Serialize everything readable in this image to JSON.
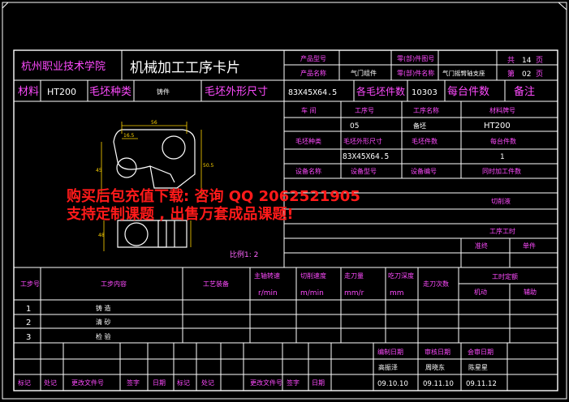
{
  "header": {
    "school": "杭州职业技术学院",
    "card_title": "机械加工工序卡片",
    "product_model_label": "产品型号",
    "product_name_label": "产品名称",
    "product_name_value": "气门组件",
    "part_drawing_label": "零(部)件图号",
    "part_name_label": "零(部)件名称",
    "part_name_value": "气门摇臂轴支座",
    "total_label": "共",
    "total_pages": "14",
    "page_unit_1": "页",
    "current_label": "第",
    "current_page": "02",
    "page_unit_2": "页"
  },
  "material_row": {
    "material_label": "材料",
    "material_value": "HT200",
    "blank_type_label": "毛坯种类",
    "blank_type_value": "铸件",
    "blank_size_label": "毛坯外形尺寸",
    "blank_size_value": "83X45X64.5",
    "blank_count_label": "各毛坯件数",
    "blank_count_value": "10303",
    "per_unit_label": "每台件数",
    "remark_label": "备注"
  },
  "right_panel": {
    "workshop_label": "车  间",
    "process_no_label": "工序号",
    "process_name_label": "工序名称",
    "material_no_label": "材料牌号",
    "process_no_value": "05",
    "process_name_value": "备坯",
    "material_no_value": "HT200",
    "blank_type_label": "毛坯种类",
    "blank_size_label": "毛坯外形尺寸",
    "blank_count_label": "毛坯件数",
    "per_unit_label": "每台件数",
    "blank_size_value": "83X45X64.5",
    "per_unit_value": "1",
    "equip_name_label": "设备名称",
    "equip_model_label": "设备型号",
    "equip_no_label": "设备编号",
    "concurrent_label": "同时加工件数",
    "coolant_label": "切削液",
    "hours_label": "工序工时",
    "standard_label": "准终",
    "unit_label": "单件"
  },
  "drawing": {
    "scale_label": "比例1: 2",
    "dim_56": "56",
    "dim_16_5": "16.5",
    "dim_45": "45",
    "dim_50_5": "50.5",
    "dim_48": "48"
  },
  "watermark": {
    "line1": "购买后包充值下载: 咨询 QQ 2062521905",
    "line2": "支持定制课题 , 出售万套成品课题!"
  },
  "steps_table": {
    "headers": {
      "step_no": "工步号",
      "step_content": "工步内容",
      "equipment": "工艺装备",
      "spindle": "主轴转速",
      "spindle_unit": "r/min",
      "cut_speed": "切削速度",
      "cut_speed_unit": "m/min",
      "feed": "走刀量",
      "feed_unit": "mm/r",
      "depth": "吃刀深度",
      "depth_unit": "mm",
      "passes": "走刀次数",
      "time_quota": "工时定额",
      "machine": "机动",
      "aux": "辅助"
    },
    "rows": [
      {
        "no": "1",
        "content": "铸    造"
      },
      {
        "no": "2",
        "content": "清    砂"
      },
      {
        "no": "3",
        "content": "检    验"
      }
    ]
  },
  "signoff": {
    "compile_label": "编制日期",
    "review_label": "审核日期",
    "approve_label": "会审日期",
    "compiler": "高振泽",
    "reviewer": "周晓东",
    "approver": "陈星星",
    "compile_date": "09.10.10",
    "review_date": "09.11.10",
    "approve_date": "09.11.12",
    "mark": "标记",
    "place": "处记",
    "change_doc": "更改文件号",
    "sign": "签字",
    "date": "日期"
  }
}
